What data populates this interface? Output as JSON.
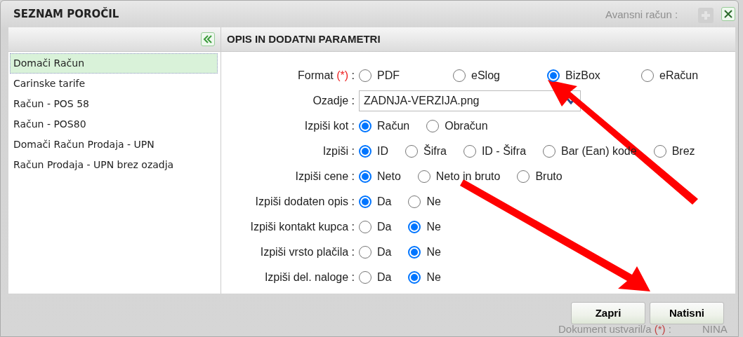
{
  "window": {
    "title": "SEZNAM POROČIL"
  },
  "background_fields": [
    {
      "kind": "top",
      "label": "Avansni račun :"
    },
    {
      "kind": "bottom",
      "label": "Dokument ustvaril/a",
      "required_mark": "(*)",
      "suffix": ":",
      "value": "NINA"
    }
  ],
  "sidebar": {
    "items": [
      {
        "label": "Domači Račun",
        "selected": true
      },
      {
        "label": "Carinske tarife",
        "selected": false
      },
      {
        "label": "Račun - POS 58",
        "selected": false
      },
      {
        "label": "Račun - POS80",
        "selected": false
      },
      {
        "label": "Domači Račun Prodaja - UPN",
        "selected": false
      },
      {
        "label": "Račun Prodaja - UPN brez ozadja",
        "selected": false
      }
    ]
  },
  "panel": {
    "title": "OPIS IN DODATNI PARAMETRI",
    "rows": [
      {
        "kind": "radio",
        "label": "Format",
        "required_mark": "(*)",
        "colon": ":",
        "wide": true,
        "options": [
          {
            "label": "PDF",
            "selected": false
          },
          {
            "label": "eSlog",
            "selected": false
          },
          {
            "label": "BizBox",
            "selected": true
          },
          {
            "label": "eRačun",
            "selected": false
          }
        ]
      },
      {
        "kind": "select",
        "label": "Ozadje",
        "colon": ":",
        "value": "ZADNJA-VERZIJA.png"
      },
      {
        "kind": "radio",
        "label": "Izpiši kot",
        "colon": ":",
        "options": [
          {
            "label": "Račun",
            "selected": true
          },
          {
            "label": "Obračun",
            "selected": false
          }
        ]
      },
      {
        "kind": "radio",
        "label": "Izpiši",
        "colon": ":",
        "options": [
          {
            "label": "ID",
            "selected": true
          },
          {
            "label": "Šifra",
            "selected": false
          },
          {
            "label": "ID - Šifra",
            "selected": false
          },
          {
            "label": "Bar (Ean) kode",
            "selected": false
          },
          {
            "label": "Brez",
            "selected": false
          }
        ]
      },
      {
        "kind": "radio",
        "label": "Izpiši cene",
        "colon": ":",
        "options": [
          {
            "label": "Neto",
            "selected": true
          },
          {
            "label": "Neto in bruto",
            "selected": false
          },
          {
            "label": "Bruto",
            "selected": false
          }
        ]
      },
      {
        "kind": "radio",
        "label": "Izpiši dodaten opis",
        "colon": ":",
        "options": [
          {
            "label": "Da",
            "selected": true
          },
          {
            "label": "Ne",
            "selected": false
          }
        ]
      },
      {
        "kind": "radio",
        "label": "Izpiši kontakt kupca",
        "colon": ":",
        "options": [
          {
            "label": "Da",
            "selected": false
          },
          {
            "label": "Ne",
            "selected": true
          }
        ]
      },
      {
        "kind": "radio",
        "label": "Izpiši vrsto plačila",
        "colon": ":",
        "options": [
          {
            "label": "Da",
            "selected": false
          },
          {
            "label": "Ne",
            "selected": true
          }
        ]
      },
      {
        "kind": "radio",
        "label": "Izpiši del. naloge",
        "colon": ":",
        "options": [
          {
            "label": "Da",
            "selected": false
          },
          {
            "label": "Ne",
            "selected": true
          }
        ]
      }
    ]
  },
  "buttons": [
    {
      "label": "Zapri"
    },
    {
      "label": "Natisni"
    }
  ]
}
